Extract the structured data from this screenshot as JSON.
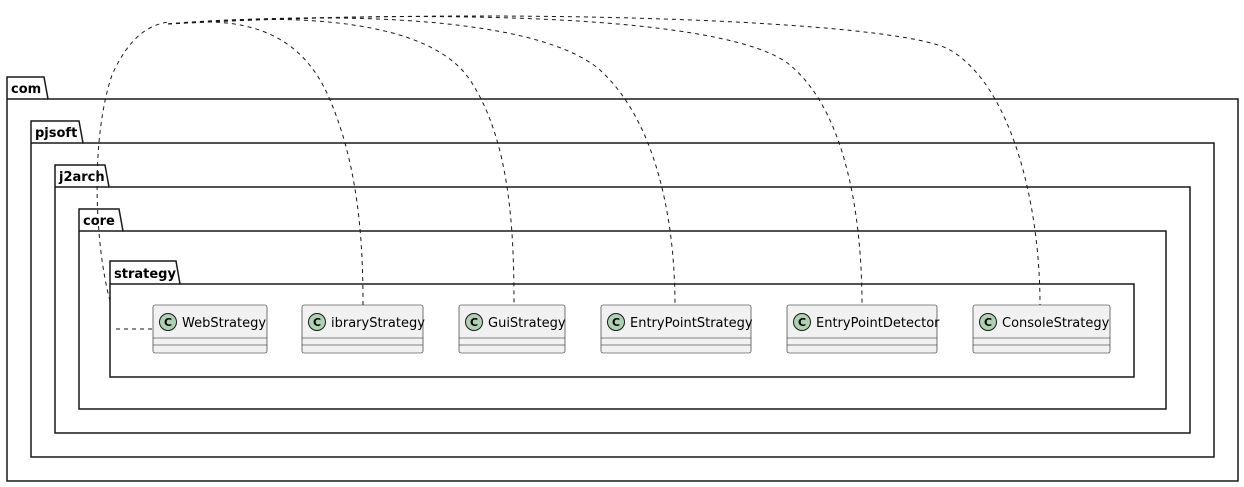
{
  "packages": [
    {
      "name": "com"
    },
    {
      "name": "pjsoft"
    },
    {
      "name": "j2arch"
    },
    {
      "name": "core"
    },
    {
      "name": "strategy"
    }
  ],
  "classes": [
    {
      "name": "WebStrategy",
      "stereotype": "C"
    },
    {
      "name": "ibraryStrategy",
      "stereotype": "C"
    },
    {
      "name": "GuiStrategy",
      "stereotype": "C"
    },
    {
      "name": "EntryPointStrategy",
      "stereotype": "C"
    },
    {
      "name": "EntryPointDetector",
      "stereotype": "C"
    },
    {
      "name": "ConsoleStrategy",
      "stereotype": "C"
    }
  ],
  "colors": {
    "class_fill": "#f1f1f1",
    "class_border": "#181818",
    "glyph_fill": "#add1b2",
    "line": "#181818",
    "package_fill": "#ffffff"
  }
}
